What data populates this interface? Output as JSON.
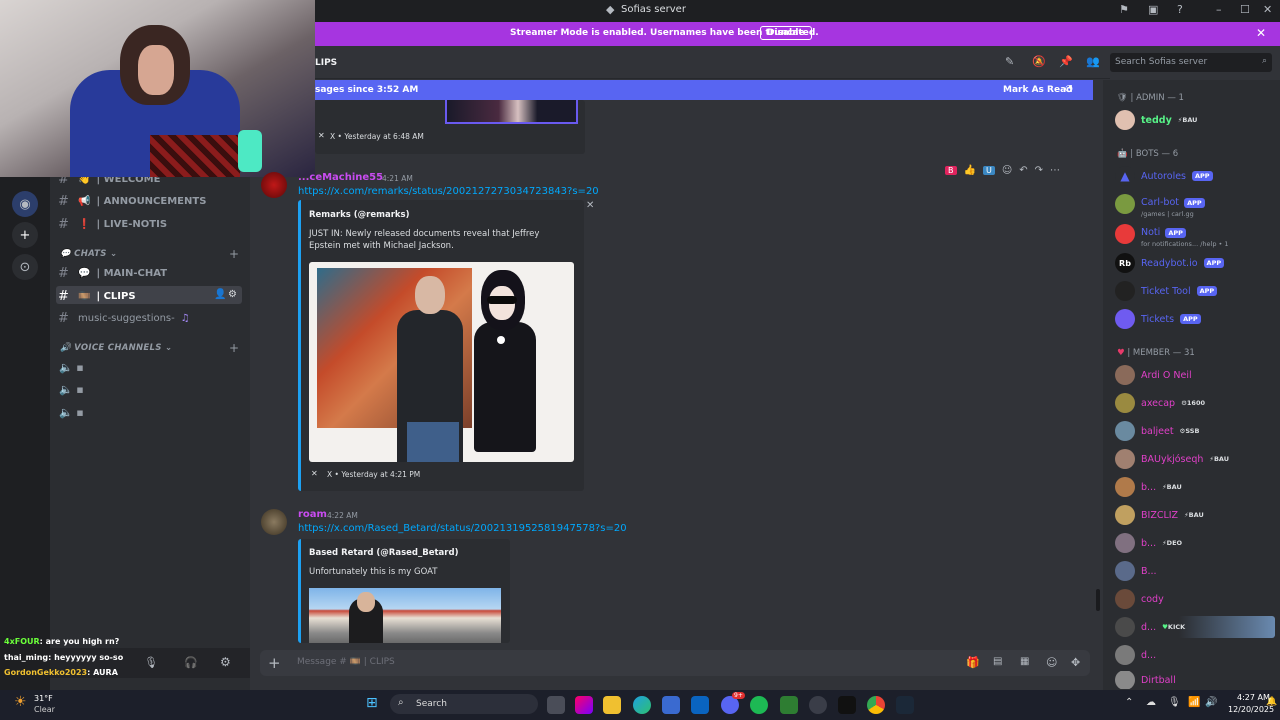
{
  "window": {
    "title": "Sofias server"
  },
  "banner": {
    "text": "Streamer Mode is enabled. Usernames have been truncated.",
    "button": "Disable"
  },
  "sidebar": {
    "channels": [
      {
        "emoji": "👋",
        "name": "| WELCOME"
      },
      {
        "emoji": "📢",
        "name": "| ANNOUNCEMENTS"
      },
      {
        "emoji": "❗",
        "name": "| LIVE-NOTIS"
      }
    ],
    "chats_category": "CHATS",
    "chat_channels": [
      {
        "emoji": "💬",
        "name": "| MAIN-CHAT"
      },
      {
        "emoji": "🎞️",
        "name": "| CLIPS"
      }
    ],
    "music_channel": "music-suggestions-",
    "voice_category": "VOICE CHANNELS"
  },
  "stream_chat": [
    {
      "user": "4xFOUR",
      "text": ": are you high rn?"
    },
    {
      "user": "thai_ming",
      "text": ": heyyyyyy so-so"
    },
    {
      "user": "GordonGekko2023",
      "text": ": AURA"
    }
  ],
  "header": {
    "channel": "LIPS",
    "search_placeholder": "Search Sofias server"
  },
  "new_messages": {
    "left": "sages since 3:52 AM",
    "right": "Mark As Read"
  },
  "messages": [
    {
      "user": "...ceMachine55",
      "time": "4:21 AM",
      "link": "https://x.com/remarks/status/2002127273034723843?s=20",
      "embed_author": "Remarks (@remarks)",
      "embed_text": "JUST IN: Newly released documents reveal that Jeffrey Epstein met with Michael Jackson.",
      "embed_footer": "X • Yesterday at 4:21 PM"
    },
    {
      "user": "roam",
      "time": "4:22 AM",
      "link": "https://x.com/Rased_Betard/status/2002131952581947578?s=20",
      "embed_author": "Based Retard (@Rased_Betard)",
      "embed_text": "Unfortunately this is my GOAT"
    }
  ],
  "prev_footer": "X • Yesterday at 6:48 AM",
  "composer": {
    "placeholder": "Message # 🎞️ | CLIPS"
  },
  "members": {
    "admin_cat": "| ADMIN — 1",
    "admin": [
      {
        "name": "teddy",
        "badge": "BAU"
      }
    ],
    "bots_cat": "| BOTS — 6",
    "bots": [
      {
        "name": "Autoroles",
        "tag": "APP",
        "sub": ""
      },
      {
        "name": "Carl-bot",
        "tag": "APP",
        "sub": "/games | carl.gg"
      },
      {
        "name": "Noti",
        "tag": "APP",
        "sub": "for notifications... /help • 1"
      },
      {
        "name": "Readybot.io",
        "tag": "APP",
        "sub": ""
      },
      {
        "name": "Ticket Tool",
        "tag": "APP",
        "sub": ""
      },
      {
        "name": "Tickets",
        "tag": "APP",
        "sub": ""
      }
    ],
    "member_cat": "| MEMBER — 31",
    "list": [
      {
        "name": "Ardi O Neil",
        "badge": ""
      },
      {
        "name": "axecap",
        "badge": "1600"
      },
      {
        "name": "baljeet",
        "badge": "SSB"
      },
      {
        "name": "BAUykjóseqh",
        "badge": "BAU"
      },
      {
        "name": "b...",
        "badge": "BAU"
      },
      {
        "name": "BIZCLIZ",
        "badge": "BAU"
      },
      {
        "name": "b...",
        "badge": "DEO"
      },
      {
        "name": "B...",
        "badge": ""
      },
      {
        "name": "cody",
        "badge": ""
      },
      {
        "name": "d...",
        "badge": "KICK"
      },
      {
        "name": "d...",
        "badge": ""
      },
      {
        "name": "Dirtball",
        "badge": ""
      }
    ]
  },
  "taskbar": {
    "weather_temp": "31°F",
    "weather_desc": "Clear",
    "search": "Search",
    "time": "4:27 AM",
    "date": "12/20/2025",
    "discord_badge": "9+"
  }
}
